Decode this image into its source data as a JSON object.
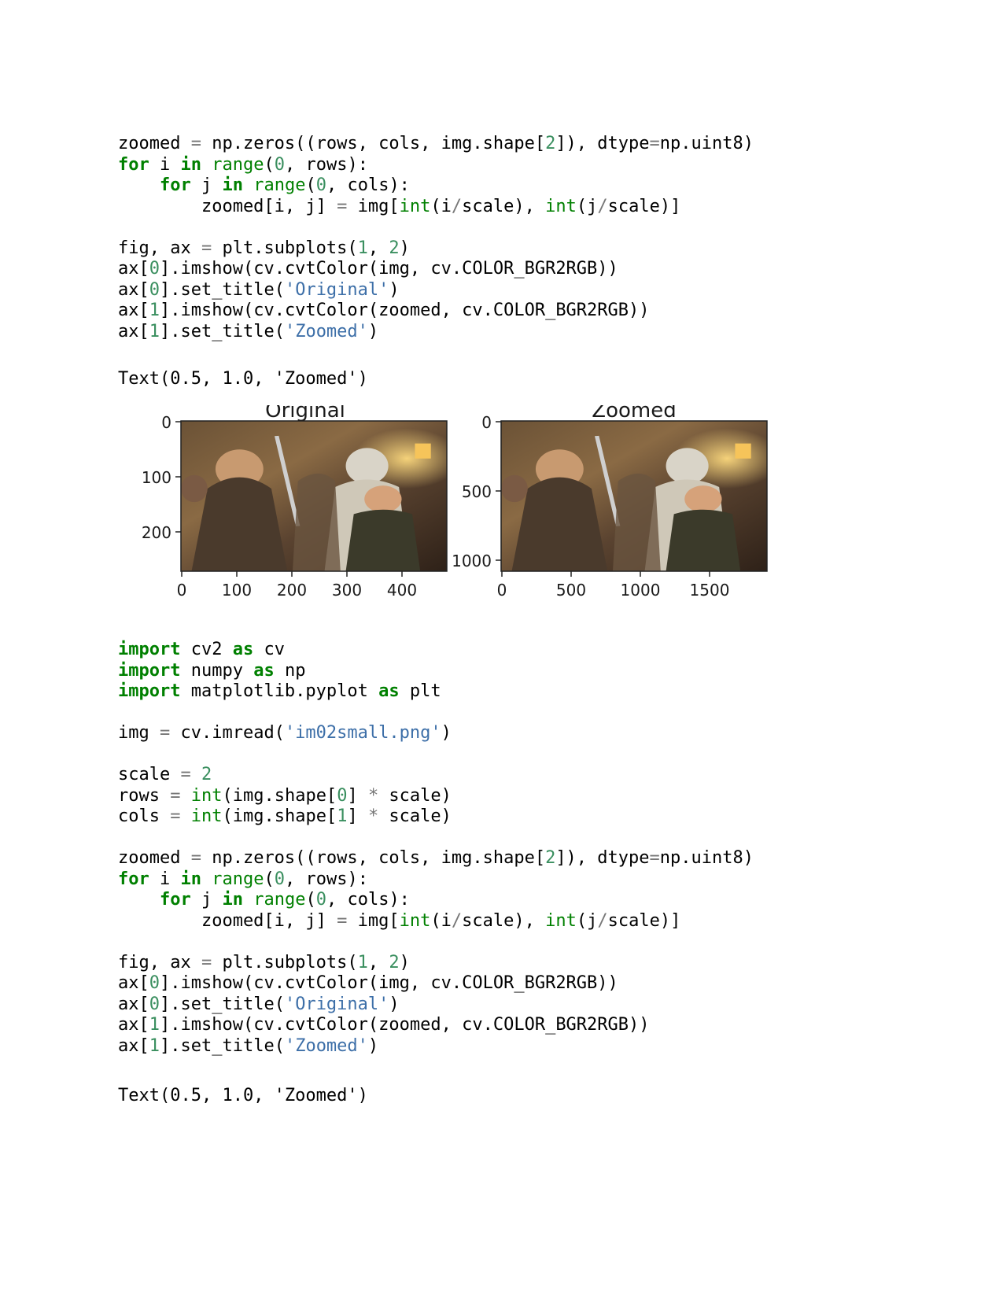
{
  "code_cell_1": [
    [
      [
        "zoomed ",
        ""
      ],
      [
        "=",
        "op"
      ],
      [
        " np.zeros((rows, cols, img.shape[",
        ""
      ],
      [
        "2",
        "num"
      ],
      [
        "]), dtype",
        ""
      ],
      [
        "=",
        "op"
      ],
      [
        "np.uint8)",
        ""
      ]
    ],
    [
      [
        "for",
        "kw"
      ],
      [
        " i ",
        ""
      ],
      [
        "in",
        "kw"
      ],
      [
        " ",
        ""
      ],
      [
        "range",
        "bi"
      ],
      [
        "(",
        ""
      ],
      [
        "0",
        "num"
      ],
      [
        ", rows):",
        ""
      ]
    ],
    [
      [
        "    ",
        ""
      ],
      [
        "for",
        "kw"
      ],
      [
        " j ",
        ""
      ],
      [
        "in",
        "kw"
      ],
      [
        " ",
        ""
      ],
      [
        "range",
        "bi"
      ],
      [
        "(",
        ""
      ],
      [
        "0",
        "num"
      ],
      [
        ", cols):",
        ""
      ]
    ],
    [
      [
        "        zoomed[i, j] ",
        ""
      ],
      [
        "=",
        "op"
      ],
      [
        " img[",
        ""
      ],
      [
        "int",
        "bi"
      ],
      [
        "(i",
        ""
      ],
      [
        "/",
        "op"
      ],
      [
        "scale), ",
        ""
      ],
      [
        "int",
        "bi"
      ],
      [
        "(j",
        ""
      ],
      [
        "/",
        "op"
      ],
      [
        "scale)]",
        ""
      ]
    ],
    [],
    [
      [
        "fig, ax ",
        ""
      ],
      [
        "=",
        "op"
      ],
      [
        " plt.subplots(",
        ""
      ],
      [
        "1",
        "num"
      ],
      [
        ", ",
        ""
      ],
      [
        "2",
        "num"
      ],
      [
        ")",
        ""
      ]
    ],
    [
      [
        "ax[",
        ""
      ],
      [
        "0",
        "num"
      ],
      [
        "].imshow(cv.cvtColor(img, cv.COLOR_BGR2RGB))",
        ""
      ]
    ],
    [
      [
        "ax[",
        ""
      ],
      [
        "0",
        "num"
      ],
      [
        "].set_title(",
        ""
      ],
      [
        "'Original'",
        "str"
      ],
      [
        ")",
        ""
      ]
    ],
    [
      [
        "ax[",
        ""
      ],
      [
        "1",
        "num"
      ],
      [
        "].imshow(cv.cvtColor(zoomed, cv.COLOR_BGR2RGB))",
        ""
      ]
    ],
    [
      [
        "ax[",
        ""
      ],
      [
        "1",
        "num"
      ],
      [
        "].set_title(",
        ""
      ],
      [
        "'Zoomed'",
        "str"
      ],
      [
        ")",
        ""
      ]
    ]
  ],
  "output_1": "Text(0.5, 1.0, 'Zoomed')",
  "figure": {
    "subplots": [
      {
        "title": "Original",
        "yticks": [
          "0",
          "100",
          "200"
        ],
        "xticks": [
          "0",
          "100",
          "200",
          "300",
          "400"
        ]
      },
      {
        "title": "Zoomed",
        "yticks": [
          "0",
          "500",
          "1000"
        ],
        "xticks": [
          "0",
          "500",
          "1000",
          "1500"
        ]
      }
    ]
  },
  "code_cell_2": [
    [
      [
        "import",
        "kw"
      ],
      [
        " cv2 ",
        ""
      ],
      [
        "as",
        "kw"
      ],
      [
        " cv",
        ""
      ]
    ],
    [
      [
        "import",
        "kw"
      ],
      [
        " numpy ",
        ""
      ],
      [
        "as",
        "kw"
      ],
      [
        " np",
        ""
      ]
    ],
    [
      [
        "import",
        "kw"
      ],
      [
        " matplotlib.pyplot ",
        ""
      ],
      [
        "as",
        "kw"
      ],
      [
        " plt",
        ""
      ]
    ],
    [],
    [
      [
        "img ",
        ""
      ],
      [
        "=",
        "op"
      ],
      [
        " cv.imread(",
        ""
      ],
      [
        "'im02small.png'",
        "str"
      ],
      [
        ")",
        ""
      ]
    ],
    [],
    [
      [
        "scale ",
        ""
      ],
      [
        "=",
        "op"
      ],
      [
        " ",
        ""
      ],
      [
        "2",
        "num"
      ]
    ],
    [
      [
        "rows ",
        ""
      ],
      [
        "=",
        "op"
      ],
      [
        " ",
        ""
      ],
      [
        "int",
        "bi"
      ],
      [
        "(img.shape[",
        ""
      ],
      [
        "0",
        "num"
      ],
      [
        "] ",
        ""
      ],
      [
        "*",
        "op"
      ],
      [
        " scale)",
        ""
      ]
    ],
    [
      [
        "cols ",
        ""
      ],
      [
        "=",
        "op"
      ],
      [
        " ",
        ""
      ],
      [
        "int",
        "bi"
      ],
      [
        "(img.shape[",
        ""
      ],
      [
        "1",
        "num"
      ],
      [
        "] ",
        ""
      ],
      [
        "*",
        "op"
      ],
      [
        " scale)",
        ""
      ]
    ],
    [],
    [
      [
        "zoomed ",
        ""
      ],
      [
        "=",
        "op"
      ],
      [
        " np.zeros((rows, cols, img.shape[",
        ""
      ],
      [
        "2",
        "num"
      ],
      [
        "]), dtype",
        ""
      ],
      [
        "=",
        "op"
      ],
      [
        "np.uint8)",
        ""
      ]
    ],
    [
      [
        "for",
        "kw"
      ],
      [
        " i ",
        ""
      ],
      [
        "in",
        "kw"
      ],
      [
        " ",
        ""
      ],
      [
        "range",
        "bi"
      ],
      [
        "(",
        ""
      ],
      [
        "0",
        "num"
      ],
      [
        ", rows):",
        ""
      ]
    ],
    [
      [
        "    ",
        ""
      ],
      [
        "for",
        "kw"
      ],
      [
        " j ",
        ""
      ],
      [
        "in",
        "kw"
      ],
      [
        " ",
        ""
      ],
      [
        "range",
        "bi"
      ],
      [
        "(",
        ""
      ],
      [
        "0",
        "num"
      ],
      [
        ", cols):",
        ""
      ]
    ],
    [
      [
        "        zoomed[i, j] ",
        ""
      ],
      [
        "=",
        "op"
      ],
      [
        " img[",
        ""
      ],
      [
        "int",
        "bi"
      ],
      [
        "(i",
        ""
      ],
      [
        "/",
        "op"
      ],
      [
        "scale), ",
        ""
      ],
      [
        "int",
        "bi"
      ],
      [
        "(j",
        ""
      ],
      [
        "/",
        "op"
      ],
      [
        "scale)]",
        ""
      ]
    ],
    [],
    [
      [
        "fig, ax ",
        ""
      ],
      [
        "=",
        "op"
      ],
      [
        " plt.subplots(",
        ""
      ],
      [
        "1",
        "num"
      ],
      [
        ", ",
        ""
      ],
      [
        "2",
        "num"
      ],
      [
        ")",
        ""
      ]
    ],
    [
      [
        "ax[",
        ""
      ],
      [
        "0",
        "num"
      ],
      [
        "].imshow(cv.cvtColor(img, cv.COLOR_BGR2RGB))",
        ""
      ]
    ],
    [
      [
        "ax[",
        ""
      ],
      [
        "0",
        "num"
      ],
      [
        "].set_title(",
        ""
      ],
      [
        "'Original'",
        "str"
      ],
      [
        ")",
        ""
      ]
    ],
    [
      [
        "ax[",
        ""
      ],
      [
        "1",
        "num"
      ],
      [
        "].imshow(cv.cvtColor(zoomed, cv.COLOR_BGR2RGB))",
        ""
      ]
    ],
    [
      [
        "ax[",
        ""
      ],
      [
        "1",
        "num"
      ],
      [
        "].set_title(",
        ""
      ],
      [
        "'Zoomed'",
        "str"
      ],
      [
        ")",
        ""
      ]
    ]
  ],
  "output_2": "Text(0.5, 1.0, 'Zoomed')",
  "colors": {
    "keyword": "#008000",
    "number": "#3a8f5f",
    "string": "#3d6fa8",
    "operator": "#777777"
  }
}
